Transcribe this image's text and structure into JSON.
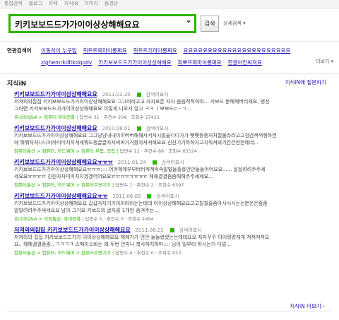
{
  "top_nav": [
    "통합검색",
    "블로그",
    "카페",
    "지식iN",
    "이미지",
    "동영상"
  ],
  "search": {
    "query": "키키보보드드가가이이상상해해요요",
    "button_label": "검색",
    "detail_label": "상세검색 ▾"
  },
  "related": {
    "title": "연관검색어",
    "links": [
      "이동식이 누구임",
      "쥐트트찌마이롱쩌요",
      "쥐트트키까아롱쩌요",
      "요요요요요요요요요요요요요요요요요요요요요요",
      "zlghemrkdltkdqodv",
      "키키보보드드가가이이상상해해요",
      "피뽀뜨찌마이롱쩌요",
      "한글이안써져요"
    ],
    "more_label": "더보기 ▾"
  },
  "kin": {
    "title": "지식iN",
    "ask_label": "지식iN에 질문하기",
    "more_label": "지식iN 더보기",
    "results": [
      {
        "title": "키키보보드드가가이이상상해해요요",
        "date": "2011.03.20",
        "check": "검색어표시",
        "snippet1": "저져의의집집 키키보보드드가가이이상상해해요요 그그러러고고 자지포존 자자 음음직직여여... 키보드 분해해버리세요, 병신",
        "snippet2": "그러면 키키보보드드가가이이상상해해요요 이렇게 나오지 않고 ㅋㅋ ㅣ보보드ㄷ--ㄱ...",
        "meta_cat": "쥬니버Q&A > 컴퓨터 휴대전화",
        "meta_info": "답변수 31 · 추천수 204 · 조회수 27421"
      },
      {
        "title": "키키보보드드가가이이상상해해요요",
        "date": "2010.08.01",
        "check": "검색어표시",
        "snippet1": "키키보보드드가가이이상상해해요요 그그냥냥내내이이버버해해서서서시흘슬디디가가 뻣뻣증증처처절불라라고고검검색색행하연",
        "snippet2": "에 뭐뭐처처나니까까미미치치게게뭐드등글글자자써써거거졌자져져해요요 신신기기하하지고지워져뵈기간간한한데데...",
        "meta_cat": "컴퓨터통신 > 컴퓨터, 하드웨어 > 컴퓨터 부품, 조립",
        "meta_info": "답변수 12 · 추천수 88 · 조회수 65524"
      },
      {
        "title": "키키보보드드가가이이상상해해요요ㅠㅠㅠ",
        "date": "2011.01.24",
        "check": "검색어표시",
        "snippet1": "키키보보드드가가이이상상해해요요ㅠㅠㅠ:::: 어어제제부부터터계계속속말말들흘흘안안들들어어요요...... 살살려려주주세",
        "snippet2": "세요요ㅠㅠㅠㅠ 진진자차미미치치겠겠어어요요ㅠㅠㅠㅠㅠㅠㅠㅠ 해해결결좀좀해해주주세세요...",
        "meta_cat": "컴퓨터통신 > 컴퓨터, 하드웨어 > 컴퓨터주변기기",
        "meta_info": "답변수 1 · 추천수 2 · 조회수 6597"
      },
      {
        "title": "키키보보드드가가이이상상해해요요ㅠㅠ",
        "date": "2011.06.02",
        "check": "검색어표시",
        "snippet1": "키키보보드드가가이이상상해해요요 갑갑자자기기이이러러는는데데 이이상상해해요요고고칠칠즐좀아시시시는는분은은좀좀",
        "snippet2": "알알려려주주세세요요 남아 그거요 키보드의 글자를 1개만 좀겨주는...",
        "meta_cat": "쥬니버Q&A > 이동통신, 휴대전화",
        "meta_info": "답변수 5 · 추천수 0 · 조회수 1494"
      },
      {
        "title": "저져의의집집 키키보보드드가가이이상상해해요요",
        "date": "2011.06.22",
        "check": "검색어표시",
        "snippet1": "저져의의 집집 키키보보드드가가 이이상상해해요요 제제가가 안안 놀놀렸렸는는데데요요 자자꾸꾸 이이렁렁게게 쳐쳐져져요",
        "snippet2": "요.. 해해결결좀좀.. ㅋㅋㅋㅋ 스페이스바는 왜 두번 안치나 복사하지하마:::: 님이 일부러 하시는거 다알...",
        "meta_cat": "컴퓨터통신 > 컴퓨터, 하드웨어 > 컴퓨터주변기기",
        "meta_info": "답변수 4 · 추천수 0 · 조회수 923"
      }
    ]
  },
  "colors": {
    "brand_green": "#2db400",
    "link_blue": "#1a0dab"
  }
}
